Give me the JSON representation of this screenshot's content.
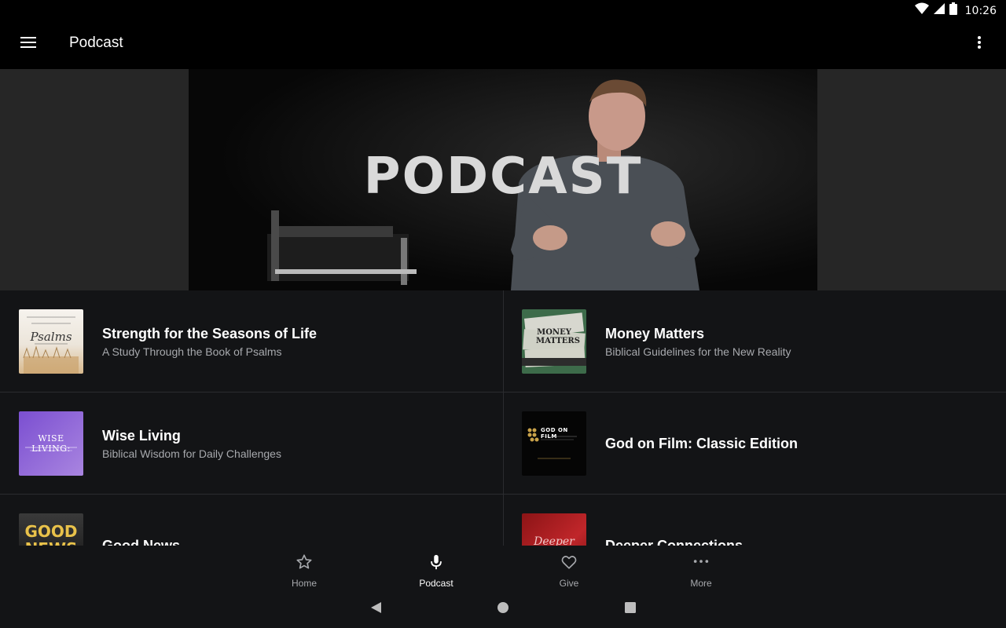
{
  "status_bar": {
    "time": "10:26"
  },
  "app_bar": {
    "title": "Podcast"
  },
  "hero": {
    "title": "PODCAST"
  },
  "podcasts": [
    {
      "title": "Strength for the Seasons of Life",
      "subtitle": "A Study Through the Book of Psalms",
      "thumb_text": "Psalms"
    },
    {
      "title": "Money Matters",
      "subtitle": "Biblical Guidelines for the New Reality",
      "thumb_text": "MONEY MATTERS"
    },
    {
      "title": "Wise Living",
      "subtitle": "Biblical Wisdom for Daily Challenges",
      "thumb_text": "WISE LIVING:"
    },
    {
      "title": "God on Film: Classic Edition",
      "subtitle": "",
      "thumb_text": "GOD ON FILM"
    },
    {
      "title": "Good News",
      "subtitle": "",
      "thumb_text": "GOOD NEWS"
    },
    {
      "title": "Deeper Connections",
      "subtitle": "",
      "thumb_text": "Deeper"
    }
  ],
  "bottom_nav": [
    {
      "label": "Home",
      "icon": "star-icon"
    },
    {
      "label": "Podcast",
      "icon": "microphone-icon",
      "active": true
    },
    {
      "label": "Give",
      "icon": "heart-icon"
    },
    {
      "label": "More",
      "icon": "more-horizontal-icon"
    }
  ],
  "colors": {
    "background": "#131416",
    "app_bar": "#000000",
    "hero_side": "#262626",
    "divider": "#2b2c2f",
    "secondary_text": "#a7a9ad"
  }
}
